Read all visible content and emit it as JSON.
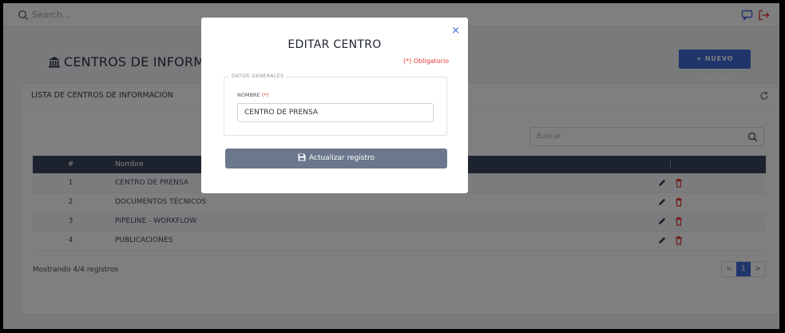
{
  "topbar": {
    "search_placeholder": "Search..."
  },
  "page": {
    "title": "CENTROS DE INFORMACIÓN",
    "new_button": "+ NUEVO CENTRO"
  },
  "card": {
    "title": "LISTA DE CENTROS DE INFORMACIÓN",
    "filter_placeholder": "Buscar",
    "columns": [
      "#",
      "Nombre",
      "⋮"
    ],
    "rows": [
      {
        "num": "1",
        "name": "CENTRO DE PRENSA"
      },
      {
        "num": "2",
        "name": "DOCUMENTOS TÉCNICOS"
      },
      {
        "num": "3",
        "name": "PIPELINE - WORKFLOW"
      },
      {
        "num": "4",
        "name": "PUBLICACIONES"
      }
    ],
    "footer": "Mostrando 4/4 registros",
    "pager": {
      "prev": "<",
      "current": "1",
      "next": ">"
    }
  },
  "modal": {
    "title": "EDITAR CENTRO",
    "close": "×",
    "required_note": "(*) Obligatorio",
    "section_legend": "DATOS GENERALES",
    "name_label": "NOMBRE",
    "name_required_mark": "(*)",
    "name_value": "CENTRO DE PRENSA",
    "update_button": "Actualizar registro"
  },
  "colors": {
    "primary": "#3f6ad8",
    "table_header": "#3a465c",
    "required": "#e53935",
    "update_button": "#6b778d",
    "delete_icon": "#e53935"
  },
  "icons": {
    "search": "search-icon",
    "chat": "chat-icon",
    "logout": "logout-icon",
    "institution": "bank-icon",
    "refresh": "refresh-icon",
    "edit": "pencil-icon",
    "delete": "trash-icon",
    "save": "floppy-icon"
  }
}
